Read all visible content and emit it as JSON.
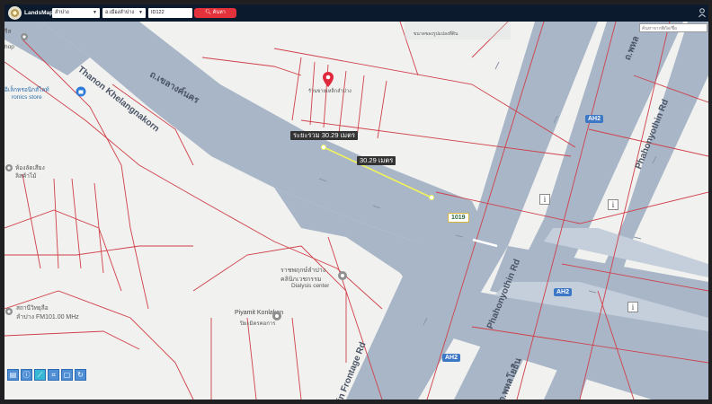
{
  "app": {
    "logo_text": "LandsMaps",
    "province_select": "ลำปาง",
    "district_select": "อ.เมืองลำปาง",
    "parcel_input": "ID122",
    "search_button": "ค้นหา",
    "coord_placeholder": "ค้นหาจากพิกัด/ชื่อ",
    "hover_tooltip": "ขนาดของรูปแปลงที่ดิน"
  },
  "map": {
    "road_labels": {
      "thanon_khelang": "Thanon Khelangnakorn",
      "thai_khelang": "ถ.เขลางค์นคร",
      "phahonyothin_rd_right": "Phahonyothin Rd",
      "phahonyothin_thai_top": "ถ.พหล",
      "phahonyothin_rd_mid": "Phahonyothin Rd",
      "frontage_rd": "in Frontage Rd",
      "phahon_thai_bottom": "ถ.พหลโยธิน"
    },
    "shields": {
      "ah2_top": "AH2",
      "ah2_mid": "AH2",
      "ah2_bottom": "AH2",
      "route_1019": "1019"
    },
    "pois": {
      "top_left_shop_line1": "รีส",
      "top_left_shop_line2": "hop",
      "electronics_thai": "อิเล็กทรอนิกส์ไลท์",
      "electronics_en": "ronics store",
      "wood_thai": "ห้องลัดเสียง",
      "wood_thai2": "ลิสค้าไม้",
      "radio_thai": "สถานีวิทยุลือ",
      "radio_en": "ลำปาง FM101.00 MHz",
      "dialysis_thai": "ราชพฤกษ์ลำปาง",
      "dialysis_thai2": "คลินิกเวชกรรม",
      "dialysis_en": "Dialysis center",
      "piyamit": "Piyamit Konlakan",
      "piyamit_thai": "ปิยะมิตรคอการ",
      "marker_label": "ร้านขายเหล็กลำปาง"
    },
    "measure": {
      "total_label": "ระยะรวม 30.29 เมตร",
      "segment_label": "30.29 เมตร"
    },
    "info_icon_symbol": "i",
    "colors": {
      "road_fill": "#a8b6c8",
      "parcel_line": "#d0404a",
      "land_bg": "#f1f1ef",
      "measure_line": "#f2f25a",
      "marker": "#e0283c",
      "topbar": "#0b1a2c"
    }
  }
}
